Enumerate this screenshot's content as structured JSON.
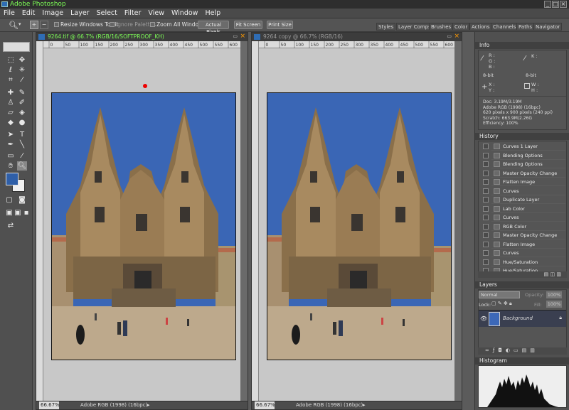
{
  "app": {
    "title": "Adobe Photoshop",
    "win_min": "_",
    "win_max": "□",
    "win_close": "×"
  },
  "menu": [
    "File",
    "Edit",
    "Image",
    "Layer",
    "Select",
    "Filter",
    "View",
    "Window",
    "Help"
  ],
  "options": {
    "resize_windows": "Resize Windows To Fit",
    "ignore_palettes": "Ignore Palettes",
    "zoom_all": "Zoom All Windows",
    "actual_pixels": "Actual Pixels",
    "fit_screen": "Fit Screen",
    "print_size": "Print Size"
  },
  "palette_well": [
    "Styles",
    "Layer Comps",
    "Brushes",
    "Color",
    "Actions",
    "Channels",
    "Paths",
    "Navigator"
  ],
  "doc_left": {
    "title": "9264.tif @ 66.7% (RGB/16/SOFTPROOF_KH)",
    "zoom": "66.67%",
    "profile": "Adobe RGB (1998) (16bpc)"
  },
  "doc_right": {
    "title": "9264 copy @ 66.7% (RGB/16)",
    "zoom": "66.67%",
    "profile": "Adobe RGB (1998) (16bpc)"
  },
  "ruler_ticks": [
    "0",
    "50",
    "100",
    "150",
    "200",
    "250",
    "300",
    "350",
    "400",
    "450",
    "500",
    "550",
    "600"
  ],
  "info": {
    "title": "Info",
    "rgb_labels": [
      "R :",
      "G :",
      "B :"
    ],
    "k_label": "K :",
    "bit_left": "8-bit",
    "bit_right": "8-bit",
    "xy": [
      "X :",
      "Y :"
    ],
    "wh": [
      "W :",
      "H :"
    ],
    "doc_lines": [
      "Doc: 3.19M/3.19M",
      "Adobe RGB (1998) (16bpc)",
      "620 pixels x 900 pixels (240 ppi)",
      "Scratch: 663.9M/2.26G",
      "Efficiency: 100%"
    ]
  },
  "history": {
    "title": "History",
    "items": [
      "Curves 1 Layer",
      "Blending Options",
      "Blending Options",
      "Master Opacity Change",
      "Flatten Image",
      "Curves",
      "Duplicate Layer",
      "Lab Color",
      "Curves",
      "RGB Color",
      "Master Opacity Change",
      "Flatten Image",
      "Curves",
      "Hue/Saturation",
      "Hue/Saturation"
    ]
  },
  "layers": {
    "title": "Layers",
    "blend_mode": "Normal",
    "opacity_label": "Opacity:",
    "opacity": "100%",
    "lock_label": "Lock:",
    "fill_label": "Fill:",
    "fill": "100%",
    "layer_name": "Background"
  },
  "histogram": {
    "title": "Histogram"
  },
  "colors": {
    "accent_title": "#7cfc56",
    "fg_swatch": "#2f5fa8",
    "bg_swatch": "#f0f0f0"
  }
}
